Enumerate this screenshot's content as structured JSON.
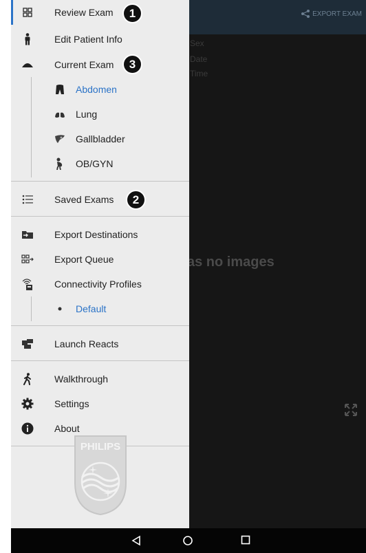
{
  "background": {
    "export_label": "EXPORT EXAM",
    "meta_labels": [
      "Sex",
      "Date",
      "Time"
    ],
    "empty_message": "as no images"
  },
  "drawer": {
    "items": [
      {
        "label": "Review Exam",
        "icon": "grid-icon"
      },
      {
        "label": "Edit Patient Info",
        "icon": "person-icon"
      },
      {
        "label": "Current Exam",
        "icon": "probe-icon"
      }
    ],
    "current_exam_subitems": [
      {
        "label": "Abdomen",
        "icon": "torso-icon",
        "selected": true
      },
      {
        "label": "Lung",
        "icon": "lungs-icon",
        "selected": false
      },
      {
        "label": "Gallbladder",
        "icon": "liver-icon",
        "selected": false
      },
      {
        "label": "OB/GYN",
        "icon": "pregnancy-icon",
        "selected": false
      }
    ],
    "saved_exams": {
      "label": "Saved Exams",
      "icon": "list-icon"
    },
    "export_items": [
      {
        "label": "Export Destinations",
        "icon": "folder-export-icon"
      },
      {
        "label": "Export Queue",
        "icon": "queue-icon"
      },
      {
        "label": "Connectivity Profiles",
        "icon": "wifi-device-icon"
      }
    ],
    "connectivity_subitems": [
      {
        "label": "Default",
        "icon": "bullet-icon",
        "selected": true
      }
    ],
    "launch_reacts": {
      "label": "Launch Reacts",
      "icon": "reacts-icon"
    },
    "help_items": [
      {
        "label": "Walkthrough",
        "icon": "walking-icon"
      },
      {
        "label": "Settings",
        "icon": "gear-icon"
      },
      {
        "label": "About",
        "icon": "info-icon"
      }
    ],
    "logo_text": "PHILIPS"
  },
  "badges": [
    "1",
    "3",
    "2"
  ],
  "colors": {
    "accent": "#2b73c7",
    "drawer_bg": "#ececec",
    "topbar": "#1e2c38"
  }
}
